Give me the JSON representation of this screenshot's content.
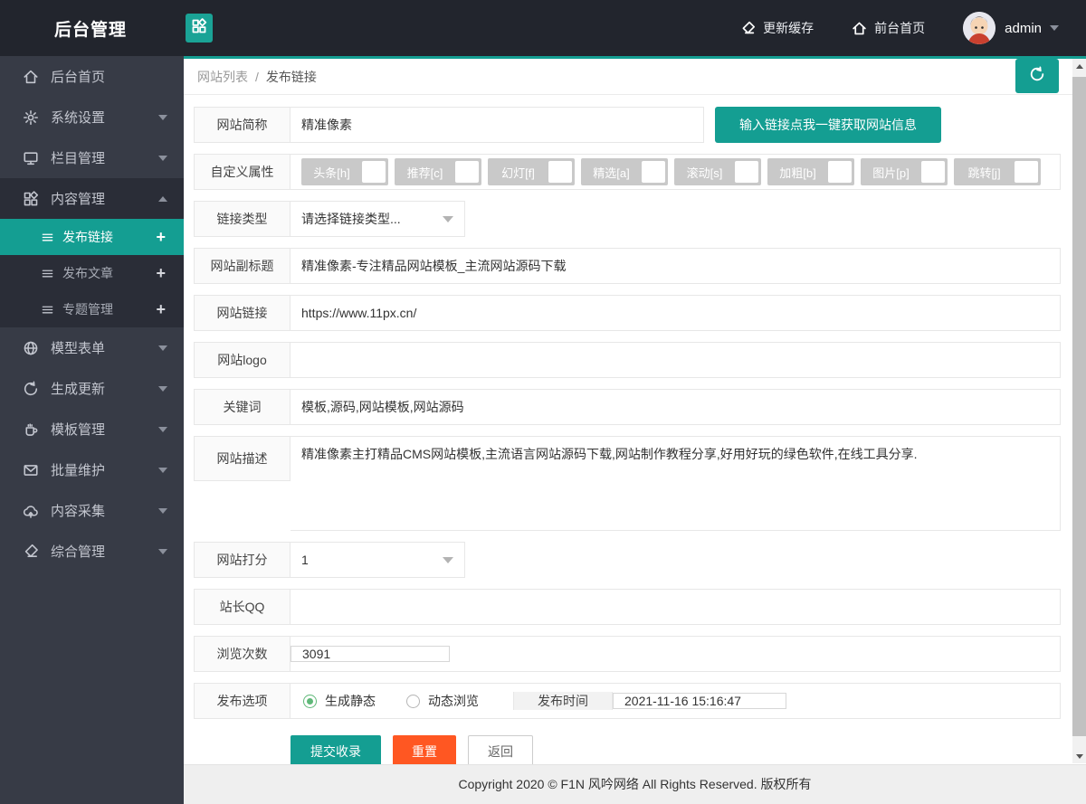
{
  "colors": {
    "accent": "#149e92",
    "reset_orange": "#ff5722",
    "radio_green": "#5fb878",
    "topbar_bg": "#22252d",
    "sidebar_bg": "#373b46"
  },
  "topbar": {
    "title": "后台管理",
    "grid_button_icon": "app-grid-icon",
    "cache_label": "更新缓存",
    "front_label": "前台首页",
    "username": "admin"
  },
  "sidebar": {
    "items": [
      {
        "label": "后台首页",
        "icon": "home-icon"
      },
      {
        "label": "系统设置",
        "icon": "gear-icon"
      },
      {
        "label": "栏目管理",
        "icon": "monitor-icon"
      },
      {
        "label": "内容管理",
        "icon": "app-grid-icon",
        "expanded": true
      },
      {
        "label": "模型表单",
        "icon": "globe-icon"
      },
      {
        "label": "生成更新",
        "icon": "refresh-icon"
      },
      {
        "label": "模板管理",
        "icon": "cup-icon"
      },
      {
        "label": "批量维护",
        "icon": "mail-icon"
      },
      {
        "label": "内容采集",
        "icon": "cloud-upload-icon"
      },
      {
        "label": "综合管理",
        "icon": "eraser-icon"
      }
    ],
    "submenu": [
      {
        "label": "发布链接",
        "plus": "+",
        "active": true
      },
      {
        "label": "发布文章",
        "plus": "+",
        "active": false
      },
      {
        "label": "专题管理",
        "plus": "+",
        "active": false
      }
    ]
  },
  "breadcrumb": {
    "parent": "网站列表",
    "separator": "/",
    "current": "发布链接"
  },
  "form": {
    "site_name": {
      "label": "网站简称",
      "value": "精准像素"
    },
    "fetch_button": "输入链接点我一键获取网站信息",
    "attributes": {
      "label": "自定义属性",
      "options": [
        "头条[h]",
        "推荐[c]",
        "幻灯[f]",
        "精选[a]",
        "滚动[s]",
        "加粗[b]",
        "图片[p]",
        "跳转[j]"
      ]
    },
    "link_type": {
      "label": "链接类型",
      "value": "请选择链接类型..."
    },
    "subtitle": {
      "label": "网站副标题",
      "value": "精准像素-专注精品网站模板_主流网站源码下载"
    },
    "url": {
      "label": "网站链接",
      "value": "https://www.11px.cn/"
    },
    "logo": {
      "label": "网站logo",
      "value": ""
    },
    "keywords": {
      "label": "关键词",
      "value": "模板,源码,网站模板,网站源码"
    },
    "description": {
      "label": "网站描述",
      "value": "精准像素主打精品CMS网站模板,主流语言网站源码下载,网站制作教程分享,好用好玩的绿色软件,在线工具分享."
    },
    "score": {
      "label": "网站打分",
      "value": "1"
    },
    "qq": {
      "label": "站长QQ",
      "value": ""
    },
    "views": {
      "label": "浏览次数",
      "value": "3091"
    },
    "publish_options": {
      "label": "发布选项",
      "options": [
        {
          "label": "生成静态",
          "selected": true
        },
        {
          "label": "动态浏览",
          "selected": false
        }
      ]
    },
    "publish_time": {
      "label": "发布时间",
      "value": "2021-11-16 15:16:47"
    },
    "buttons": {
      "submit": "提交收录",
      "reset": "重置",
      "back": "返回"
    }
  },
  "footer": {
    "copyright": "Copyright 2020 © F1N 风吟网络 All Rights Reserved. 版权所有"
  }
}
